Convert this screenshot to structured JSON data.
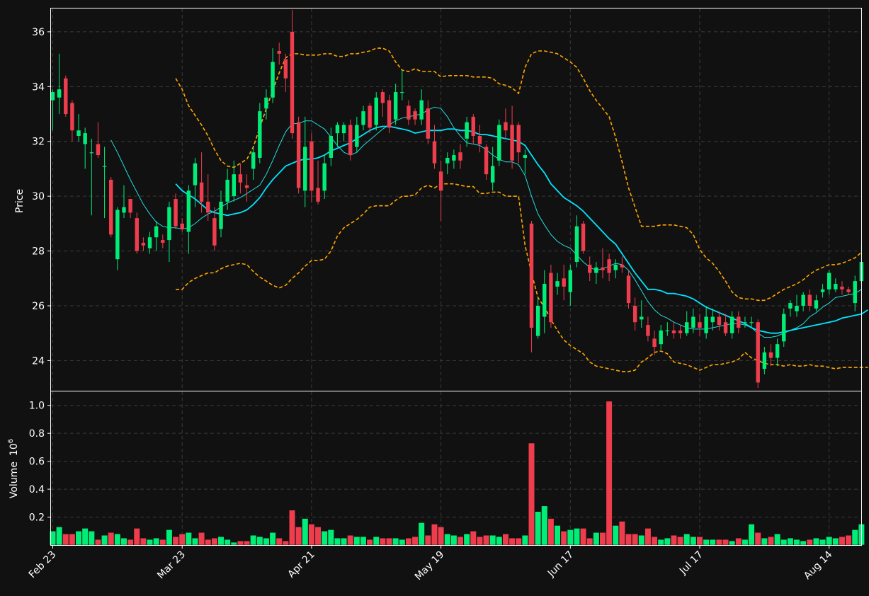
{
  "chart_data": {
    "type": "candlestick",
    "colors": {
      "background": "#111111",
      "up": "#00ee77",
      "down": "#ee3d4d",
      "ma_fast": "#22dde0",
      "ma_slow": "#00e5ff",
      "bollinger": "#ffa500",
      "axis": "#ffffff",
      "grid": "#3a3a3a"
    },
    "price_axis": {
      "label": "Price",
      "ylim": [
        22.9,
        36.85
      ],
      "ticks": [
        "24",
        "26",
        "28",
        "30",
        "32",
        "34",
        "36"
      ],
      "tick_values": [
        24,
        26,
        28,
        30,
        32,
        34,
        36
      ]
    },
    "volume_axis": {
      "label": "Volume",
      "exponent": "10",
      "exponent_power": "6",
      "ylim": [
        0,
        1.1
      ],
      "ticks": [
        "0.2",
        "0.4",
        "0.6",
        "0.8",
        "1.0"
      ],
      "tick_values": [
        0.2,
        0.4,
        0.6,
        0.8,
        1.0
      ]
    },
    "x_axis": {
      "ticks": [
        "Feb 23",
        "Mar 23",
        "Apr 21",
        "May 19",
        "Jun 17",
        "Jul 17",
        "Aug 14"
      ],
      "tick_index": [
        0,
        20,
        40,
        60,
        80,
        100,
        120
      ]
    },
    "candles": [
      [
        33.5,
        33.8,
        33.9,
        32.4
      ],
      [
        33.6,
        33.9,
        35.2,
        33.0
      ],
      [
        34.3,
        33.0,
        34.4,
        32.9
      ],
      [
        33.4,
        32.4,
        33.5,
        32.0
      ],
      [
        32.2,
        32.4,
        33.0,
        32.0
      ],
      [
        31.9,
        32.3,
        32.5,
        31.0
      ],
      [
        31.6,
        31.6,
        32.1,
        29.3
      ],
      [
        31.9,
        31.5,
        32.7,
        31.4
      ],
      [
        31.1,
        31.1,
        31.8,
        29.2
      ],
      [
        30.6,
        28.6,
        30.7,
        28.5
      ],
      [
        27.7,
        29.5,
        29.6,
        27.3
      ],
      [
        29.4,
        29.6,
        30.4,
        29.2
      ],
      [
        29.9,
        29.4,
        29.9,
        29.2
      ],
      [
        29.2,
        28.0,
        29.4,
        27.9
      ],
      [
        28.3,
        28.2,
        28.5,
        28.0
      ],
      [
        28.1,
        28.5,
        28.7,
        27.9
      ],
      [
        28.5,
        28.9,
        29.1,
        28.0
      ],
      [
        28.4,
        28.3,
        28.6,
        28.1
      ],
      [
        28.4,
        29.6,
        29.8,
        27.6
      ],
      [
        29.9,
        28.9,
        30.1,
        28.8
      ],
      [
        29.0,
        28.8,
        29.2,
        28.7
      ],
      [
        28.7,
        30.2,
        30.4,
        27.9
      ],
      [
        30.4,
        31.2,
        31.4,
        29.6
      ],
      [
        30.5,
        29.8,
        31.6,
        29.4
      ],
      [
        29.8,
        29.4,
        30.8,
        29.1
      ],
      [
        29.2,
        28.2,
        29.6,
        28.0
      ],
      [
        28.8,
        29.8,
        30.2,
        28.5
      ],
      [
        29.8,
        30.6,
        31.0,
        29.5
      ],
      [
        30.0,
        30.8,
        31.3,
        29.8
      ],
      [
        30.8,
        30.5,
        31.2,
        30.1
      ],
      [
        30.4,
        30.3,
        30.8,
        29.8
      ],
      [
        31.0,
        31.6,
        31.8,
        30.6
      ],
      [
        31.4,
        33.1,
        33.4,
        31.2
      ],
      [
        33.2,
        33.6,
        33.9,
        32.8
      ],
      [
        33.6,
        34.9,
        35.4,
        33.4
      ],
      [
        35.3,
        35.2,
        35.6,
        34.8
      ],
      [
        35.0,
        34.3,
        35.2,
        33.8
      ],
      [
        36.0,
        32.3,
        36.8,
        32.1
      ],
      [
        32.7,
        30.3,
        32.9,
        30.1
      ],
      [
        30.2,
        31.8,
        32.9,
        29.6
      ],
      [
        32.0,
        30.2,
        32.3,
        29.8
      ],
      [
        30.3,
        29.8,
        31.3,
        29.7
      ],
      [
        30.2,
        31.2,
        31.5,
        29.9
      ],
      [
        31.4,
        32.2,
        32.5,
        31.1
      ],
      [
        32.3,
        32.6,
        32.7,
        31.8
      ],
      [
        32.3,
        32.6,
        32.7,
        32.0
      ],
      [
        32.6,
        31.5,
        32.8,
        31.3
      ],
      [
        31.8,
        32.6,
        32.9,
        31.6
      ],
      [
        32.6,
        33.1,
        33.3,
        32.4
      ],
      [
        33.3,
        32.5,
        33.4,
        32.3
      ],
      [
        32.6,
        33.6,
        33.8,
        32.4
      ],
      [
        33.8,
        33.4,
        33.9,
        32.9
      ],
      [
        33.5,
        32.5,
        33.7,
        32.3
      ],
      [
        32.8,
        33.8,
        34.1,
        32.6
      ],
      [
        33.8,
        33.8,
        34.6,
        33.5
      ],
      [
        33.3,
        32.8,
        33.5,
        32.6
      ],
      [
        33.1,
        32.8,
        33.2,
        32.6
      ],
      [
        32.8,
        33.5,
        33.9,
        32.6
      ],
      [
        33.2,
        32.1,
        33.5,
        31.9
      ],
      [
        32.0,
        31.2,
        32.6,
        31.0
      ],
      [
        30.9,
        30.2,
        31.3,
        29.1
      ],
      [
        31.2,
        31.4,
        31.6,
        30.8
      ],
      [
        31.3,
        31.5,
        31.7,
        31.0
      ],
      [
        31.6,
        31.3,
        31.9,
        31.0
      ],
      [
        32.1,
        32.7,
        32.9,
        31.8
      ],
      [
        32.9,
        32.2,
        33.0,
        31.9
      ],
      [
        32.2,
        31.9,
        32.6,
        31.6
      ],
      [
        31.8,
        30.8,
        31.9,
        30.6
      ],
      [
        30.5,
        31.1,
        31.8,
        30.2
      ],
      [
        31.3,
        32.6,
        32.8,
        31.1
      ],
      [
        32.7,
        32.4,
        33.2,
        32.1
      ],
      [
        32.6,
        31.3,
        33.3,
        31.0
      ],
      [
        32.6,
        31.6,
        32.7,
        31.2
      ],
      [
        31.4,
        31.5,
        31.7,
        30.8
      ],
      [
        29.0,
        25.2,
        29.1,
        24.3
      ],
      [
        24.9,
        26.0,
        26.3,
        24.8
      ],
      [
        25.6,
        26.8,
        27.3,
        25.0
      ],
      [
        27.2,
        25.4,
        27.5,
        25.2
      ],
      [
        26.7,
        26.9,
        27.2,
        26.4
      ],
      [
        27.0,
        26.7,
        27.5,
        26.2
      ],
      [
        26.5,
        27.3,
        27.5,
        26.0
      ],
      [
        27.6,
        28.9,
        29.3,
        27.4
      ],
      [
        29.0,
        28.0,
        29.1,
        27.9
      ],
      [
        27.5,
        27.2,
        27.8,
        26.9
      ],
      [
        27.2,
        27.4,
        27.6,
        26.8
      ],
      [
        27.4,
        27.3,
        28.1,
        27.0
      ],
      [
        27.7,
        27.2,
        27.9,
        26.9
      ],
      [
        27.3,
        27.5,
        27.7,
        27.0
      ],
      [
        27.5,
        27.4,
        27.8,
        27.2
      ],
      [
        27.1,
        26.1,
        27.3,
        25.9
      ],
      [
        26.0,
        25.4,
        26.3,
        25.1
      ],
      [
        25.5,
        25.6,
        26.2,
        25.2
      ],
      [
        25.3,
        24.9,
        25.6,
        24.7
      ],
      [
        24.8,
        24.5,
        25.1,
        24.2
      ],
      [
        24.6,
        25.1,
        25.3,
        24.4
      ],
      [
        25.1,
        25.1,
        25.4,
        24.9
      ],
      [
        25.1,
        25.0,
        25.4,
        24.8
      ],
      [
        25.1,
        25.0,
        25.3,
        24.8
      ],
      [
        25.0,
        25.4,
        25.8,
        24.9
      ],
      [
        25.2,
        25.6,
        25.9,
        25.0
      ],
      [
        25.4,
        25.2,
        25.7,
        24.9
      ],
      [
        25.0,
        25.6,
        26.0,
        24.8
      ],
      [
        25.4,
        25.6,
        25.9,
        25.1
      ],
      [
        25.6,
        25.3,
        25.8,
        25.1
      ],
      [
        25.4,
        25.0,
        25.7,
        24.9
      ],
      [
        25.0,
        25.6,
        25.8,
        24.8
      ],
      [
        25.6,
        25.2,
        25.8,
        25.0
      ],
      [
        25.4,
        25.4,
        25.6,
        25.2
      ],
      [
        25.4,
        25.4,
        25.6,
        25.2
      ],
      [
        25.4,
        23.2,
        25.5,
        23.0
      ],
      [
        23.7,
        24.3,
        24.5,
        23.5
      ],
      [
        24.3,
        24.1,
        24.6,
        23.8
      ],
      [
        24.1,
        24.6,
        24.8,
        23.8
      ],
      [
        24.7,
        25.7,
        25.9,
        24.5
      ],
      [
        25.9,
        26.1,
        26.2,
        25.6
      ],
      [
        25.8,
        26.0,
        26.4,
        25.6
      ],
      [
        26.0,
        26.4,
        26.5,
        25.8
      ],
      [
        26.4,
        26.0,
        26.6,
        25.8
      ],
      [
        25.9,
        26.2,
        26.4,
        25.8
      ],
      [
        26.5,
        26.6,
        26.8,
        26.3
      ],
      [
        26.6,
        27.2,
        27.3,
        26.4
      ],
      [
        26.6,
        26.8,
        27.0,
        26.5
      ],
      [
        26.7,
        26.6,
        26.9,
        26.4
      ],
      [
        26.6,
        26.5,
        26.7,
        26.4
      ],
      [
        26.1,
        26.9,
        27.1,
        25.8
      ],
      [
        26.9,
        27.6,
        28.3,
        26.8
      ]
    ],
    "volume": [
      0.1,
      0.13,
      0.08,
      0.08,
      0.1,
      0.12,
      0.1,
      0.04,
      0.07,
      0.09,
      0.08,
      0.05,
      0.04,
      0.12,
      0.05,
      0.04,
      0.05,
      0.04,
      0.11,
      0.06,
      0.08,
      0.09,
      0.05,
      0.09,
      0.04,
      0.05,
      0.06,
      0.04,
      0.02,
      0.03,
      0.03,
      0.07,
      0.06,
      0.05,
      0.09,
      0.05,
      0.03,
      0.25,
      0.13,
      0.19,
      0.15,
      0.13,
      0.1,
      0.11,
      0.05,
      0.05,
      0.07,
      0.06,
      0.06,
      0.04,
      0.06,
      0.05,
      0.05,
      0.05,
      0.04,
      0.05,
      0.06,
      0.16,
      0.07,
      0.15,
      0.13,
      0.08,
      0.07,
      0.06,
      0.08,
      0.1,
      0.06,
      0.07,
      0.07,
      0.06,
      0.08,
      0.05,
      0.05,
      0.07,
      0.73,
      0.24,
      0.28,
      0.19,
      0.14,
      0.1,
      0.11,
      0.12,
      0.12,
      0.05,
      0.09,
      0.09,
      1.03,
      0.14,
      0.17,
      0.08,
      0.08,
      0.07,
      0.12,
      0.06,
      0.04,
      0.05,
      0.07,
      0.06,
      0.08,
      0.06,
      0.06,
      0.04,
      0.04,
      0.04,
      0.04,
      0.03,
      0.05,
      0.04,
      0.15,
      0.09,
      0.05,
      0.06,
      0.08,
      0.04,
      0.05,
      0.04,
      0.03,
      0.04,
      0.05,
      0.04,
      0.06,
      0.05,
      0.06,
      0.07,
      0.11,
      0.15
    ],
    "ma_fast": [
      null,
      null,
      null,
      null,
      null,
      null,
      null,
      null,
      null,
      32.05,
      31.6,
      31.1,
      30.6,
      30.15,
      29.7,
      29.35,
      29.05,
      28.9,
      28.85,
      28.85,
      28.8,
      28.85,
      29.0,
      29.2,
      29.35,
      29.45,
      29.6,
      29.75,
      29.85,
      29.95,
      30.1,
      30.25,
      30.4,
      30.8,
      31.3,
      31.85,
      32.35,
      32.65,
      32.65,
      32.75,
      32.75,
      32.6,
      32.45,
      32.15,
      31.85,
      31.6,
      31.5,
      31.6,
      31.85,
      32.05,
      32.25,
      32.45,
      32.6,
      32.75,
      32.85,
      32.9,
      32.95,
      33.0,
      33.15,
      33.25,
      33.2,
      32.9,
      32.5,
      32.2,
      31.95,
      31.9,
      31.85,
      31.7,
      31.5,
      31.35,
      31.25,
      31.25,
      31.15,
      30.75,
      30.0,
      29.35,
      28.95,
      28.6,
      28.35,
      28.2,
      28.1,
      27.85,
      27.6,
      27.4,
      27.3,
      27.35,
      27.45,
      27.55,
      27.5,
      27.3,
      26.95,
      26.55,
      26.15,
      25.85,
      25.65,
      25.55,
      25.4,
      25.3,
      25.2,
      25.15,
      25.15,
      25.15,
      25.2,
      25.25,
      25.3,
      25.35,
      25.35,
      25.3,
      25.2,
      25.0,
      24.85,
      24.85,
      24.9,
      25.0,
      25.1,
      25.2,
      25.35,
      25.6,
      25.75,
      25.95,
      26.1,
      26.3,
      26.35,
      26.4,
      26.45,
      26.6
    ],
    "ma_slow": [
      null,
      null,
      null,
      null,
      null,
      null,
      null,
      null,
      null,
      null,
      null,
      null,
      null,
      null,
      null,
      null,
      null,
      null,
      null,
      30.45,
      30.2,
      30.05,
      29.9,
      29.7,
      29.5,
      29.4,
      29.35,
      29.3,
      29.35,
      29.4,
      29.5,
      29.7,
      29.95,
      30.3,
      30.6,
      30.85,
      31.1,
      31.2,
      31.3,
      31.35,
      31.35,
      31.4,
      31.5,
      31.65,
      31.75,
      31.85,
      31.95,
      32.1,
      32.25,
      32.4,
      32.5,
      32.55,
      32.55,
      32.5,
      32.45,
      32.4,
      32.3,
      32.35,
      32.4,
      32.4,
      32.4,
      32.45,
      32.45,
      32.4,
      32.4,
      32.35,
      32.25,
      32.25,
      32.2,
      32.15,
      32.1,
      32.05,
      32.0,
      31.85,
      31.5,
      31.15,
      30.85,
      30.45,
      30.2,
      29.95,
      29.8,
      29.65,
      29.45,
      29.2,
      28.95,
      28.7,
      28.45,
      28.25,
      27.9,
      27.55,
      27.2,
      26.9,
      26.6,
      26.6,
      26.55,
      26.45,
      26.45,
      26.4,
      26.35,
      26.25,
      26.1,
      25.95,
      25.85,
      25.75,
      25.65,
      25.55,
      25.45,
      25.35,
      25.2,
      25.1,
      25.05,
      25.0,
      25.0,
      25.05,
      25.1,
      25.15,
      25.2,
      25.25,
      25.3,
      25.35,
      25.4,
      25.45,
      25.55,
      25.6,
      25.65,
      25.7,
      25.85
    ],
    "bb_upper": [
      null,
      null,
      null,
      null,
      null,
      null,
      null,
      null,
      null,
      null,
      null,
      null,
      null,
      null,
      null,
      null,
      null,
      null,
      null,
      34.3,
      33.9,
      33.3,
      32.95,
      32.6,
      32.2,
      31.7,
      31.3,
      31.1,
      31.05,
      31.2,
      31.35,
      31.8,
      32.5,
      33.2,
      33.85,
      34.5,
      35.05,
      35.2,
      35.2,
      35.15,
      35.15,
      35.15,
      35.2,
      35.2,
      35.1,
      35.1,
      35.2,
      35.2,
      35.25,
      35.3,
      35.4,
      35.4,
      35.3,
      34.9,
      34.6,
      34.55,
      34.65,
      34.55,
      34.55,
      34.55,
      34.35,
      34.4,
      34.4,
      34.4,
      34.4,
      34.35,
      34.35,
      34.35,
      34.3,
      34.1,
      34.05,
      33.95,
      33.75,
      34.7,
      35.2,
      35.3,
      35.3,
      35.25,
      35.2,
      35.05,
      34.9,
      34.7,
      34.3,
      33.85,
      33.5,
      33.2,
      32.9,
      32.15,
      31.25,
      30.3,
      29.6,
      28.9,
      28.9,
      28.9,
      28.95,
      28.95,
      28.95,
      28.9,
      28.85,
      28.6,
      28.05,
      27.75,
      27.55,
      27.25,
      26.9,
      26.5,
      26.3,
      26.25,
      26.25,
      26.2,
      26.2,
      26.3,
      26.45,
      26.6,
      26.7,
      26.8,
      26.95,
      27.15,
      27.3,
      27.4,
      27.5,
      27.5,
      27.55,
      27.65,
      27.75,
      27.95
    ],
    "bb_lower": [
      null,
      null,
      null,
      null,
      null,
      null,
      null,
      null,
      null,
      null,
      null,
      null,
      null,
      null,
      null,
      null,
      null,
      null,
      null,
      26.6,
      26.6,
      26.85,
      27.0,
      27.1,
      27.2,
      27.2,
      27.35,
      27.45,
      27.5,
      27.55,
      27.5,
      27.25,
      27.05,
      26.9,
      26.75,
      26.65,
      26.75,
      27.0,
      27.2,
      27.45,
      27.65,
      27.65,
      27.7,
      28.0,
      28.55,
      28.85,
      29.0,
      29.15,
      29.35,
      29.6,
      29.65,
      29.65,
      29.65,
      29.85,
      30.0,
      30.0,
      30.05,
      30.3,
      30.4,
      30.3,
      30.45,
      30.45,
      30.45,
      30.4,
      30.35,
      30.35,
      30.1,
      30.1,
      30.15,
      30.15,
      30.0,
      30.0,
      30.0,
      28.2,
      27.2,
      26.3,
      25.95,
      25.5,
      25.1,
      24.75,
      24.55,
      24.4,
      24.25,
      23.95,
      23.8,
      23.75,
      23.7,
      23.65,
      23.6,
      23.6,
      23.65,
      23.95,
      24.1,
      24.3,
      24.35,
      24.25,
      23.95,
      23.9,
      23.85,
      23.75,
      23.65,
      23.75,
      23.85,
      23.85,
      23.9,
      23.95,
      24.05,
      24.3,
      24.1,
      24.0,
      23.9,
      23.85,
      23.85,
      23.8,
      23.85,
      23.8,
      23.8,
      23.85,
      23.8,
      23.8,
      23.75,
      23.7,
      23.75,
      23.75,
      23.75,
      23.75,
      23.75
    ]
  }
}
